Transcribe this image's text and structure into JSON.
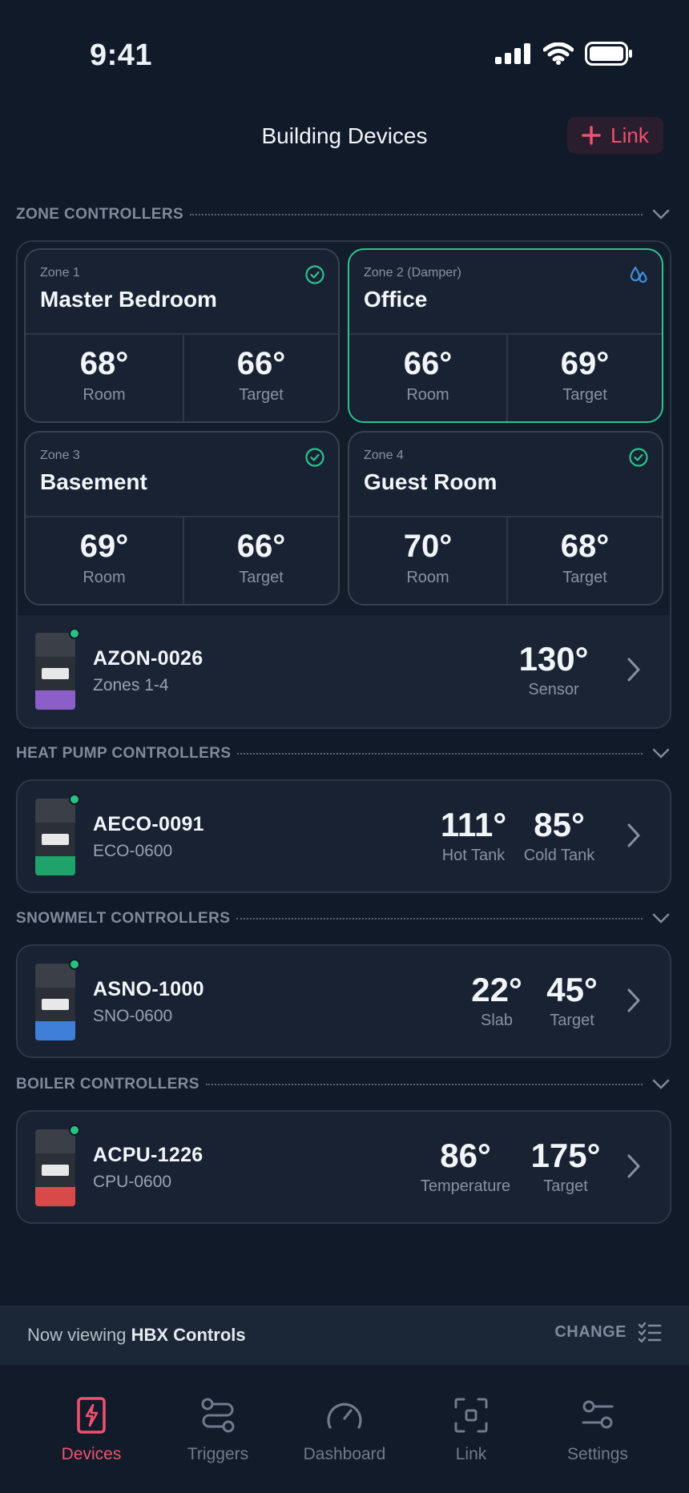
{
  "status_bar": {
    "time": "9:41"
  },
  "header": {
    "title": "Building Devices",
    "link_button": "Link"
  },
  "sections": {
    "zone": "ZONE CONTROLLERS",
    "heat_pump": "HEAT PUMP CONTROLLERS",
    "snowmelt": "SNOWMELT CONTROLLERS",
    "boiler": "BOILER CONTROLLERS"
  },
  "zones": [
    {
      "label": "Zone 1",
      "name": "Master Bedroom",
      "room": "68°",
      "room_caption": "Room",
      "target": "66°",
      "target_caption": "Target",
      "status": "check-circle-icon"
    },
    {
      "label": "Zone 2 (Damper)",
      "name": "Office",
      "room": "66°",
      "room_caption": "Room",
      "target": "69°",
      "target_caption": "Target",
      "status": "droplets-icon"
    },
    {
      "label": "Zone 3",
      "name": "Basement",
      "room": "69°",
      "room_caption": "Room",
      "target": "66°",
      "target_caption": "Target",
      "status": "check-circle-icon"
    },
    {
      "label": "Zone 4",
      "name": "Guest Room",
      "room": "70°",
      "room_caption": "Room",
      "target": "68°",
      "target_caption": "Target",
      "status": "check-circle-icon"
    }
  ],
  "devices": {
    "zone": {
      "name": "AZON-0026",
      "model": "Zones 1-4",
      "stats": [
        {
          "value": "130°",
          "caption": "Sensor"
        }
      ],
      "accent": "#8b5fc7"
    },
    "heat_pump": {
      "name": "AECO-0091",
      "model": "ECO-0600",
      "stats": [
        {
          "value": "111°",
          "caption": "Hot Tank"
        },
        {
          "value": "85°",
          "caption": "Cold Tank"
        }
      ],
      "accent": "#1fa36b"
    },
    "snowmelt": {
      "name": "ASNO-1000",
      "model": "SNO-0600",
      "stats": [
        {
          "value": "22°",
          "caption": "Slab"
        },
        {
          "value": "45°",
          "caption": "Target"
        }
      ],
      "accent": "#3f7fd9"
    },
    "boiler": {
      "name": "ACPU-1226",
      "model": "CPU-0600",
      "stats": [
        {
          "value": "86°",
          "caption": "Temperature"
        },
        {
          "value": "175°",
          "caption": "Target"
        }
      ],
      "accent": "#d84a4a"
    }
  },
  "banner": {
    "prefix": "Now viewing ",
    "org": "HBX Controls",
    "change": "CHANGE"
  },
  "tabs": [
    {
      "label": "Devices",
      "icon": "device-bolt-icon",
      "active": true
    },
    {
      "label": "Triggers",
      "icon": "triggers-icon",
      "active": false
    },
    {
      "label": "Dashboard",
      "icon": "gauge-icon",
      "active": false
    },
    {
      "label": "Link",
      "icon": "scan-icon",
      "active": false
    },
    {
      "label": "Settings",
      "icon": "sliders-icon",
      "active": false
    }
  ],
  "colors": {
    "accent_pink": "#f0516f",
    "accent_green": "#2ec28f",
    "accent_blue": "#3f8fe0",
    "background": "#101a28"
  }
}
